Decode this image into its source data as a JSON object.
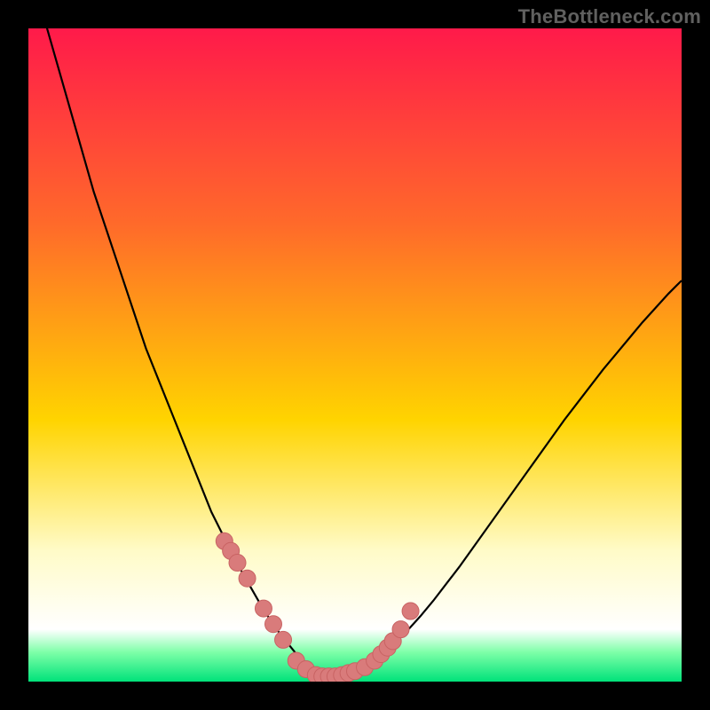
{
  "watermark": "TheBottleneck.com",
  "colors": {
    "frame": "#000000",
    "grad_top": "#ff1a4a",
    "grad_mid1": "#ff6a2a",
    "grad_mid2": "#ffd400",
    "grad_mid3": "#fffbc8",
    "grad_bottom1": "#7effa8",
    "grad_bottom2": "#00e27a",
    "curve": "#000000",
    "marker_fill": "#d97b7b",
    "marker_stroke": "#c86363"
  },
  "chart_data": {
    "type": "line",
    "title": "",
    "xlabel": "",
    "ylabel": "",
    "xlim": [
      0,
      100
    ],
    "ylim": [
      0,
      100
    ],
    "x": [
      0,
      2,
      4,
      6,
      8,
      10,
      12,
      14,
      16,
      18,
      20,
      22,
      24,
      26,
      28,
      30,
      32,
      34,
      36,
      38,
      40,
      42,
      43,
      44,
      45,
      46,
      47,
      48,
      50,
      52,
      54,
      56,
      58,
      60,
      62,
      64,
      66,
      68,
      70,
      72,
      74,
      76,
      78,
      80,
      82,
      84,
      86,
      88,
      90,
      92,
      94,
      96,
      98,
      100
    ],
    "y": [
      110,
      103,
      96,
      89,
      82,
      75,
      69,
      63,
      57,
      51,
      46,
      41,
      36,
      31,
      26,
      22,
      18,
      14.5,
      11,
      8,
      5.5,
      3,
      2,
      1.4,
      1,
      0.8,
      0.8,
      1,
      1.6,
      2.6,
      4,
      5.8,
      7.8,
      10,
      12.4,
      15,
      17.6,
      20.4,
      23.2,
      26,
      28.8,
      31.6,
      34.4,
      37.2,
      40,
      42.6,
      45.2,
      47.8,
      50.2,
      52.6,
      55,
      57.2,
      59.4,
      61.4
    ],
    "series": [
      {
        "name": "markers",
        "x": [
          30,
          31,
          32,
          33.5,
          36,
          37.5,
          39,
          41,
          42.5,
          44,
          45,
          46,
          47,
          48,
          49,
          50,
          51.5,
          53,
          54,
          55,
          55.8,
          57,
          58.5
        ],
        "y": [
          21.5,
          20,
          18.2,
          15.8,
          11.2,
          8.8,
          6.4,
          3.2,
          1.9,
          1.0,
          0.8,
          0.8,
          0.8,
          1.0,
          1.3,
          1.6,
          2.2,
          3.2,
          4.2,
          5.2,
          6.2,
          8.0,
          10.8
        ]
      }
    ],
    "gradient_stops": [
      {
        "offset": 0.0,
        "color": "#ff1a4a"
      },
      {
        "offset": 0.3,
        "color": "#ff6a2a"
      },
      {
        "offset": 0.6,
        "color": "#ffd400"
      },
      {
        "offset": 0.8,
        "color": "#fffbc8"
      },
      {
        "offset": 0.92,
        "color": "#ffffff"
      },
      {
        "offset": 0.955,
        "color": "#7effa8"
      },
      {
        "offset": 1.0,
        "color": "#00e27a"
      }
    ]
  }
}
